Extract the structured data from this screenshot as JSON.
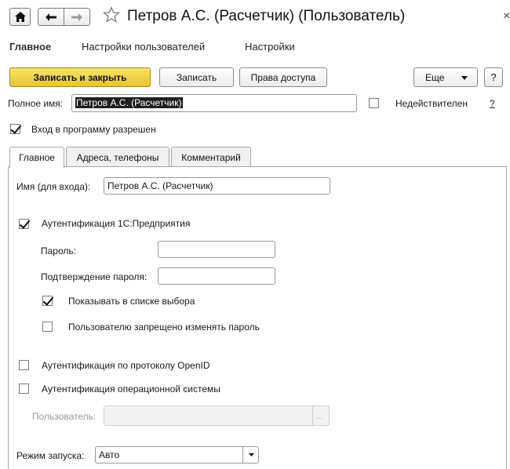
{
  "window": {
    "title": "Петров А.С. (Расчетчик) (Пользователь)",
    "close_glyph": "×"
  },
  "nav_tabs": [
    {
      "label": "Главное"
    },
    {
      "label": "Настройки пользователей"
    },
    {
      "label": "Настройки"
    }
  ],
  "toolbar": {
    "save_close_label": "Записать и закрыть",
    "save_label": "Записать",
    "access_label": "Права доступа",
    "more_label": "Еще",
    "help_label": "?"
  },
  "fullname": {
    "label": "Полное имя:",
    "value": "Петров А.С. (Расчетчик)",
    "invalid_label": "Недействителен",
    "invalid_help": "?"
  },
  "login_allowed": {
    "label": "Вход в программу разрешен",
    "checked": true
  },
  "inner_tabs": [
    {
      "label": "Главное"
    },
    {
      "label": "Адреса, телефоны"
    },
    {
      "label": "Комментарий"
    }
  ],
  "main": {
    "login_name_label": "Имя (для входа):",
    "login_name_value": "Петров А.С. (Расчетчик)",
    "auth_1c": {
      "label": "Аутентификация 1С:Предприятия",
      "checked": true
    },
    "password_label": "Пароль:",
    "password_confirm_label": "Подтверждение пароля:",
    "show_in_list": {
      "label": "Показывать в списке выбора",
      "checked": true
    },
    "no_change_password": {
      "label": "Пользователю запрещено изменять пароль",
      "checked": false
    },
    "auth_openid": {
      "label": "Аутентификация по протоколу OpenID",
      "checked": false
    },
    "auth_os": {
      "label": "Аутентификация операционной системы",
      "checked": false
    },
    "os_user_label": "Пользователь:",
    "os_user_button": "...",
    "launch_mode_label": "Режим запуска:",
    "launch_mode_value": "Авто"
  },
  "colors": {
    "primary_button": "#f0d44a",
    "selected_text_bg": "#1f1f1f"
  }
}
